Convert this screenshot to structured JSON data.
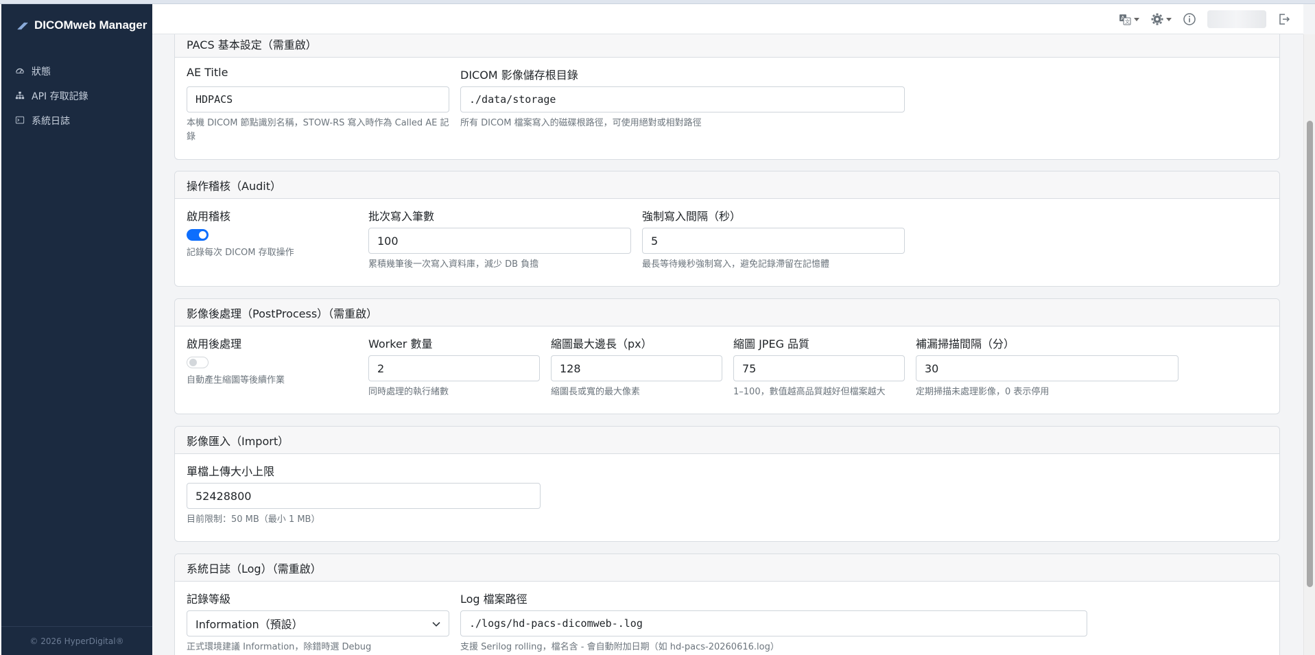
{
  "app": {
    "brand": "DICOMweb Manager",
    "footer": "© 2026 HyperDigital®"
  },
  "sidebar": {
    "items": [
      {
        "label": "狀態",
        "icon": "dashboard-gauge-icon"
      },
      {
        "label": "API 存取記錄",
        "icon": "sitemap-icon"
      },
      {
        "label": "系統日誌",
        "icon": "terminal-icon"
      }
    ]
  },
  "header": {
    "icons": [
      "translate-icon",
      "gear-icon",
      "info-icon",
      "logout-icon"
    ]
  },
  "sections": {
    "pacs": {
      "title": "PACS 基本設定（需重啟）",
      "ae_title": {
        "label": "AE Title",
        "value": "HDPACS",
        "help": "本機 DICOM 節點識別名稱，STOW-RS 寫入時作為 Called AE 記錄"
      },
      "storage_root": {
        "label": "DICOM 影像儲存根目錄",
        "value": "./data/storage",
        "help": "所有 DICOM 檔案寫入的磁碟根路徑，可使用絕對或相對路徑"
      }
    },
    "audit": {
      "title": "操作稽核（Audit）",
      "enable": {
        "label": "啟用稽核",
        "on": true,
        "help": "記錄每次 DICOM 存取操作"
      },
      "batch_size": {
        "label": "批次寫入筆數",
        "value": "100",
        "help": "累積幾筆後一次寫入資料庫，減少 DB 負擔"
      },
      "flush_interval": {
        "label": "強制寫入間隔（秒）",
        "value": "5",
        "help": "最長等待幾秒強制寫入，避免記錄滯留在記憶體"
      }
    },
    "postprocess": {
      "title": "影像後處理（PostProcess）（需重啟）",
      "enable": {
        "label": "啟用後處理",
        "on": false,
        "help": "自動產生縮圖等後續作業"
      },
      "workers": {
        "label": "Worker 數量",
        "value": "2",
        "help": "同時處理的執行緒數"
      },
      "thumb_max": {
        "label": "縮圖最大邊長（px）",
        "value": "128",
        "help": "縮圖長或寬的最大像素"
      },
      "jpeg_quality": {
        "label": "縮圖 JPEG 品質",
        "value": "75",
        "help": "1–100，數值越高品質越好但檔案越大"
      },
      "scan_interval": {
        "label": "補漏掃描間隔（分）",
        "value": "30",
        "help": "定期掃描未處理影像，0 表示停用"
      }
    },
    "import": {
      "title": "影像匯入（Import）",
      "max_upload": {
        "label": "單檔上傳大小上限",
        "value": "52428800",
        "help": "目前限制：50 MB（最小 1 MB）"
      }
    },
    "log": {
      "title": "系統日誌（Log）（需重啟）",
      "level": {
        "label": "記錄等級",
        "value": "Information（預設）",
        "help": "正式環境建議 Information，除錯時選 Debug"
      },
      "path": {
        "label": "Log 檔案路徑",
        "value": "./logs/hd-pacs-dicomweb-.log",
        "help": "支援 Serilog rolling，檔名含 - 會自動附加日期（如 hd-pacs-20260616.log）"
      }
    }
  },
  "colors": {
    "sidebar_bg": "#1b2a40",
    "accent": "#0d6efd",
    "card_header_bg": "#f7f7f8"
  }
}
